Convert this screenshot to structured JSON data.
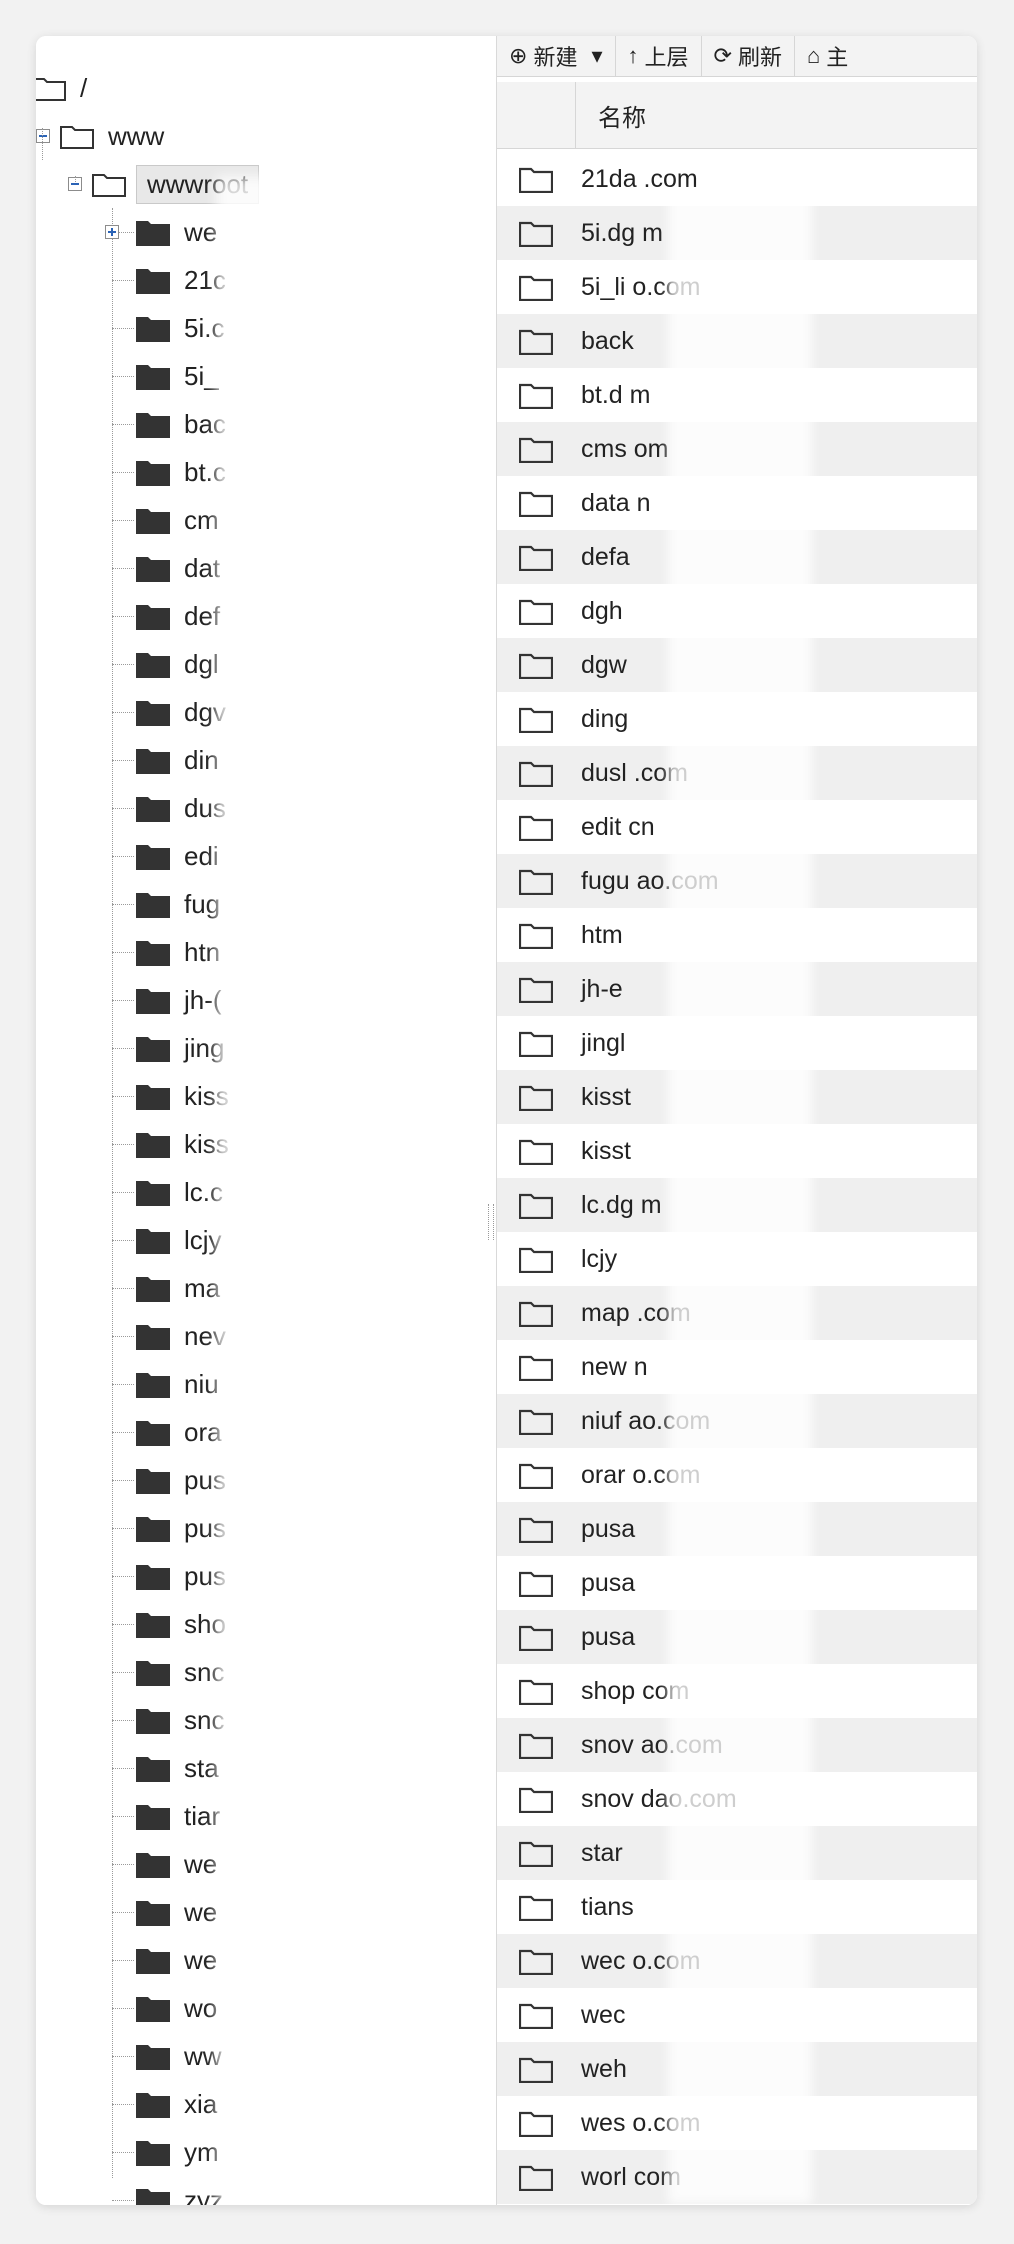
{
  "tree": {
    "root_label": "/",
    "www_label": "www",
    "wwwroot_label": "wwwroot",
    "items": [
      "we",
      "21c",
      "5i.c",
      "5i_",
      "bac",
      "bt.c",
      "cm",
      "dat",
      "def",
      "dgl",
      "dgv",
      "din",
      "dus",
      "edi",
      "fug",
      "htn",
      "jh-(",
      "jing",
      "kiss",
      "kiss",
      "lc.c",
      "lcjy",
      "ma",
      "nev",
      "niu",
      "ora",
      "pus",
      "pus",
      "pus",
      "sho",
      "snc",
      "snc",
      "sta",
      "tiar",
      "we",
      "we",
      "we",
      "wo",
      "ww",
      "xia",
      "ym",
      "zyz"
    ]
  },
  "toolbar": {
    "new_label": "新建",
    "up_label": "上层",
    "refresh_label": "刷新",
    "home_label": "主"
  },
  "table": {
    "name_header": "名称",
    "rows": [
      "21da                .com",
      "5i.dg              m",
      "5i_li              o.com",
      "back",
      "bt.d               m",
      "cms                om",
      "data               n",
      "defa",
      "dgh",
      "dgw",
      "ding",
      "dusl               .com",
      "edit               cn",
      "fugu               ao.com",
      "htm",
      "jh-e",
      "jingl",
      "kisst",
      "kisst",
      "lc.dg              m",
      "lcjy",
      "map                .com",
      "new                n",
      "niuf               ao.com",
      "orar               o.com",
      "pusa",
      "pusa",
      "pusa",
      "shop               com",
      "snov               ao.com",
      "snov               dao.com",
      "star",
      "tians",
      "wec                o.com",
      "wec",
      "weh",
      "wes                o.com",
      "worl               com"
    ]
  }
}
